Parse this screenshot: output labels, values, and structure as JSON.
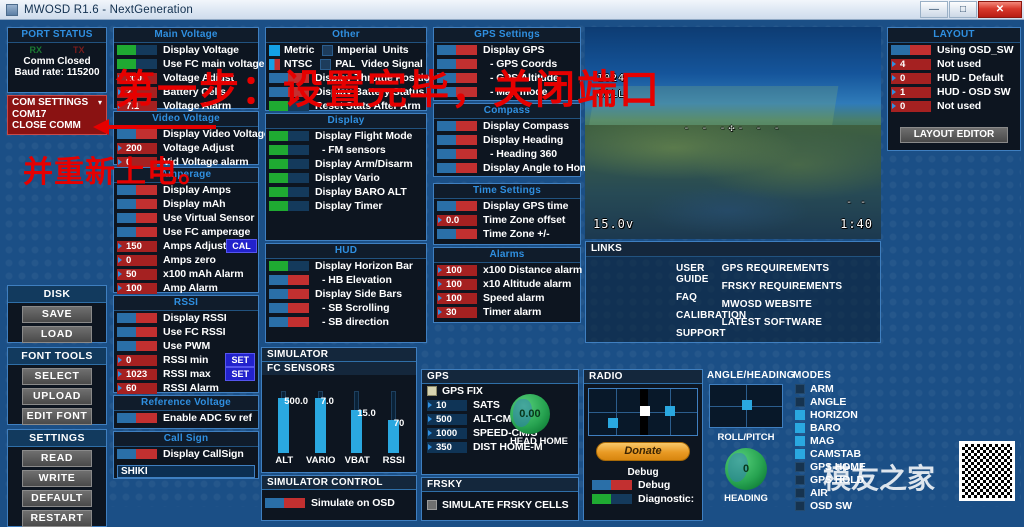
{
  "window": {
    "title": "MWOSD R1.6 - NextGeneration",
    "minimize": "—",
    "maximize": "□",
    "close": "✕"
  },
  "port_status": {
    "title": "PORT STATUS",
    "rx": "RX",
    "tx": "TX",
    "comm": "Comm Closed",
    "baud": "Baud rate: 115200",
    "com_settings": "COM SETTINGS",
    "com_port": "COM17",
    "close_comm": "CLOSE COMM"
  },
  "left_tools": {
    "disk": "DISK",
    "save": "SAVE",
    "load": "LOAD",
    "font_tools": "FONT TOOLS",
    "select": "SELECT",
    "upload": "UPLOAD",
    "edit_font": "EDIT FONT",
    "settings": "SETTINGS",
    "read": "READ",
    "write": "WRITE",
    "default": "DEFAULT",
    "restart": "RESTART"
  },
  "main_voltage": {
    "title": "Main Voltage",
    "rows": [
      {
        "label": "Display Voltage",
        "type": "toggle",
        "state": "on"
      },
      {
        "label": "Use FC main voltage",
        "type": "toggle",
        "state": "on"
      },
      {
        "label": "Voltage Adjust",
        "type": "num",
        "value": "200"
      },
      {
        "label": "Battery Cells",
        "type": "num",
        "value": "2"
      },
      {
        "label": "Voltage Alarm",
        "type": "num",
        "value": "7.1"
      }
    ]
  },
  "video_voltage": {
    "title": "Video Voltage",
    "rows": [
      {
        "label": "Display Video Voltage",
        "type": "toggle",
        "state": "off"
      },
      {
        "label": "Voltage Adjust",
        "type": "num",
        "value": "200"
      },
      {
        "label": "Vid Voltage alarm",
        "type": "num",
        "value": "0"
      }
    ]
  },
  "amperage": {
    "title": "Amperage",
    "rows": [
      {
        "label": "Display Amps",
        "type": "toggle",
        "state": "off"
      },
      {
        "label": "Display mAh",
        "type": "toggle",
        "state": "off"
      },
      {
        "label": "Use Virtual Sensor",
        "type": "toggle",
        "state": "off"
      },
      {
        "label": "Use FC amperage",
        "type": "toggle",
        "state": "off"
      },
      {
        "label": "Amps Adjust",
        "type": "num",
        "value": "150",
        "button": "CAL"
      },
      {
        "label": "Amps zero",
        "type": "num",
        "value": "0"
      },
      {
        "label": "x100 mAh Alarm",
        "type": "num",
        "value": "50"
      },
      {
        "label": "Amp Alarm",
        "type": "num",
        "value": "100"
      }
    ]
  },
  "rssi": {
    "title": "RSSI",
    "rows": [
      {
        "label": "Display RSSI",
        "type": "toggle",
        "state": "off"
      },
      {
        "label": "Use FC RSSI",
        "type": "toggle",
        "state": "off"
      },
      {
        "label": "Use PWM",
        "type": "toggle",
        "state": "off"
      },
      {
        "label": "RSSI min",
        "type": "num",
        "value": "0",
        "button": "SET"
      },
      {
        "label": "RSSI max",
        "type": "num",
        "value": "1023",
        "button": "SET"
      },
      {
        "label": "RSSI Alarm",
        "type": "num",
        "value": "60"
      }
    ]
  },
  "reference_voltage": {
    "title": "Reference Voltage",
    "rows": [
      {
        "label": "Enable ADC 5v ref",
        "type": "toggle",
        "state": "off"
      }
    ]
  },
  "call_sign": {
    "title": "Call Sign",
    "rows": [
      {
        "label": "Display CallSign",
        "type": "toggle",
        "state": "off"
      }
    ],
    "value": "SHIKI"
  },
  "other": {
    "title": "Other",
    "units_metric": "Metric",
    "units_imperial": "Imperial",
    "units_label": "Units",
    "video_ntsc": "NTSC",
    "video_pal": "PAL",
    "video_label": "Video Signal",
    "rows": [
      {
        "label": "Display Throttle Position",
        "type": "toggle",
        "state": "off"
      },
      {
        "label": "Display Battery Status",
        "type": "toggle",
        "state": "off"
      },
      {
        "label": "Reset Stats After Arm",
        "type": "toggle",
        "state": "on"
      }
    ]
  },
  "display": {
    "title": "Display",
    "rows": [
      {
        "label": "Display Flight Mode",
        "type": "toggle",
        "state": "on"
      },
      {
        "label": "- FM sensors",
        "type": "toggle",
        "state": "on"
      },
      {
        "label": "Display Arm/Disarm",
        "type": "toggle",
        "state": "on"
      },
      {
        "label": "Display Vario",
        "type": "toggle",
        "state": "on"
      },
      {
        "label": "Display BARO ALT",
        "type": "toggle",
        "state": "on"
      },
      {
        "label": "Display Timer",
        "type": "toggle",
        "state": "on"
      }
    ]
  },
  "hud": {
    "title": "HUD",
    "rows": [
      {
        "label": "Display Horizon Bar",
        "type": "toggle",
        "state": "on"
      },
      {
        "label": "- HB Elevation",
        "type": "toggle",
        "state": "off"
      },
      {
        "label": "Display Side Bars",
        "type": "toggle",
        "state": "off"
      },
      {
        "label": "- SB Scrolling",
        "type": "toggle",
        "state": "off"
      },
      {
        "label": "- SB direction",
        "type": "toggle",
        "state": "off"
      }
    ]
  },
  "gps_settings": {
    "title": "GPS Settings",
    "rows": [
      {
        "label": "Display GPS",
        "type": "toggle",
        "state": "off"
      },
      {
        "label": "- GPS Coords",
        "type": "toggle",
        "state": "off"
      },
      {
        "label": "- GPS Altitude",
        "type": "toggle",
        "state": "off"
      },
      {
        "label": "- Map mode",
        "type": "toggle",
        "state": "off"
      }
    ]
  },
  "compass": {
    "title": "Compass",
    "rows": [
      {
        "label": "Display Compass",
        "type": "toggle",
        "state": "off"
      },
      {
        "label": "Display Heading",
        "type": "toggle",
        "state": "off"
      },
      {
        "label": "- Heading 360",
        "type": "toggle",
        "state": "off"
      },
      {
        "label": "Display Angle to Home",
        "type": "toggle",
        "state": "off"
      }
    ]
  },
  "time_settings": {
    "title": "Time Settings",
    "rows": [
      {
        "label": "Display GPS time",
        "type": "toggle",
        "state": "off"
      },
      {
        "label": "Time Zone offset",
        "type": "num",
        "value": "0.0"
      },
      {
        "label": "Time Zone +/-",
        "type": "toggle",
        "state": "off"
      }
    ]
  },
  "alarms": {
    "title": "Alarms",
    "rows": [
      {
        "label": "x100 Distance alarm",
        "type": "num",
        "value": "100"
      },
      {
        "label": "x10   Altitude alarm",
        "type": "num",
        "value": "100"
      },
      {
        "label": "Speed alarm",
        "type": "num",
        "value": "100"
      },
      {
        "label": "Timer alarm",
        "type": "num",
        "value": "30"
      }
    ]
  },
  "layout": {
    "title": "LAYOUT",
    "rows": [
      {
        "label": "Using OSD_SW",
        "type": "toggle",
        "state": "off"
      },
      {
        "label": "Not used",
        "type": "num",
        "value": "4"
      },
      {
        "label": "HUD - Default",
        "type": "num",
        "value": "0"
      },
      {
        "label": "HUD - OSD SW",
        "type": "num",
        "value": "1"
      },
      {
        "label": "Not used",
        "type": "num",
        "value": "0"
      }
    ],
    "editor_button": "LAYOUT EDITOR"
  },
  "links": {
    "title": "LINKS",
    "col1": [
      "USER GUIDE",
      "FAQ",
      "CALIBRATION",
      "SUPPORT"
    ],
    "col2": [
      "GPS REQUIREMENTS",
      "FRSKY REQUIREMENTS",
      "MWOSD WEBSITE",
      "LATEST SOFTWARE"
    ]
  },
  "osd_preview": {
    "rssi": "1024",
    "callsign": "CALL",
    "voltage": "15.0v",
    "timer": "1:40",
    "dashes": "- -"
  },
  "simulator": {
    "title": "SIMULATOR",
    "fc_sensors": {
      "title": "FC SENSORS",
      "sliders": [
        {
          "label": "ALT",
          "value": "500.0",
          "pct": 88
        },
        {
          "label": "VARIO",
          "value": "7.0",
          "pct": 88
        },
        {
          "label": "VBAT",
          "value": "15.0",
          "pct": 70
        },
        {
          "label": "RSSI",
          "value": "70",
          "pct": 54
        }
      ]
    },
    "control": {
      "title": "SIMULATOR CONTROL",
      "rows": [
        {
          "label": "Simulate on OSD",
          "type": "toggle",
          "state": "off"
        }
      ]
    },
    "gps": {
      "title": "GPS",
      "fix_label": "GPS FIX",
      "rows": [
        {
          "label": "SATS",
          "value": "10"
        },
        {
          "label": "ALT-CM",
          "value": "500"
        },
        {
          "label": "SPEED-CM/S",
          "value": "1000"
        },
        {
          "label": "DIST HOME-M",
          "value": "350"
        }
      ],
      "head_home_value": "0.00",
      "head_home_label": "HEAD HOME"
    },
    "frsky": {
      "title": "FRSKY",
      "checkbox_label": "SIMULATE FRSKY CELLS"
    },
    "radio": {
      "title": "RADIO",
      "donate": "Donate",
      "debug_header": "Debug",
      "debug_label": "Debug",
      "diagnostic_label": "Diagnostic:"
    },
    "angle_heading": {
      "title": "ANGLE/HEADING",
      "roll_pitch": "ROLL/PITCH",
      "heading_value": "0",
      "heading_label": "HEADING"
    },
    "modes": {
      "title": "MODES",
      "items": [
        {
          "label": "ARM",
          "checked": false
        },
        {
          "label": "ANGLE",
          "checked": false
        },
        {
          "label": "HORIZON",
          "checked": true
        },
        {
          "label": "BARO",
          "checked": true
        },
        {
          "label": "MAG",
          "checked": true
        },
        {
          "label": "CAMSTAB",
          "checked": true
        },
        {
          "label": "GPS HOME",
          "checked": false
        },
        {
          "label": "GPS HOLD",
          "checked": false
        },
        {
          "label": "AIR",
          "checked": false
        },
        {
          "label": "OSD SW",
          "checked": false
        }
      ]
    }
  },
  "annotations": {
    "step": "第一步：设置完毕，关闭端口",
    "restart": "并重新上电。",
    "watermark": "模友之家"
  },
  "colors": {
    "accent_blue": "#2f8fe0",
    "toggle_on": "#1faa32",
    "toggle_off": "#c23030",
    "panel_bg": "#0d1520",
    "app_bg": "#1b4f86"
  }
}
